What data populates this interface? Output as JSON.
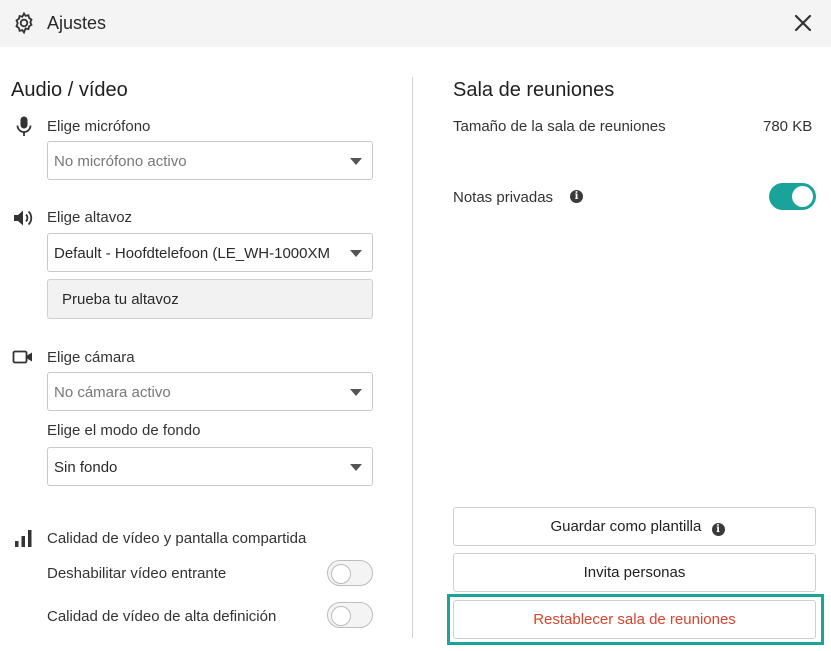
{
  "header": {
    "title": "Ajustes",
    "settings_icon": "gear-icon",
    "close_icon": "close-icon"
  },
  "audio_video": {
    "title": "Audio / vídeo",
    "microphone": {
      "label": "Elige micrófono",
      "value": "No micrófono activo",
      "icon": "microphone-icon"
    },
    "speaker": {
      "label": "Elige altavoz",
      "value": "Default - Hoofdtelefoon (LE_WH-1000XM",
      "icon": "speaker-icon",
      "test_button": "Prueba tu altavoz"
    },
    "camera": {
      "label": "Elige cámara",
      "value": "No cámara activo",
      "icon": "camera-icon"
    },
    "background": {
      "label": "Elige el modo de fondo",
      "value": "Sin fondo"
    },
    "quality": {
      "label": "Calidad de vídeo y pantalla compartida",
      "icon": "signal-bars-icon",
      "disable_incoming": {
        "label": "Deshabilitar vídeo entrante",
        "on": false
      },
      "hd": {
        "label": "Calidad de vídeo de alta definición",
        "on": false
      }
    }
  },
  "room": {
    "title": "Sala de reuniones",
    "size_label": "Tamaño de la sala de reuniones",
    "size_value": "780 KB",
    "private_notes": {
      "label": "Notas privadas",
      "on": true
    },
    "actions": {
      "save_template": "Guardar como plantilla",
      "invite": "Invita personas",
      "reset": "Restablecer sala de reuniones"
    }
  },
  "colors": {
    "accent": "#1aa39b",
    "danger": "#d8442e"
  }
}
